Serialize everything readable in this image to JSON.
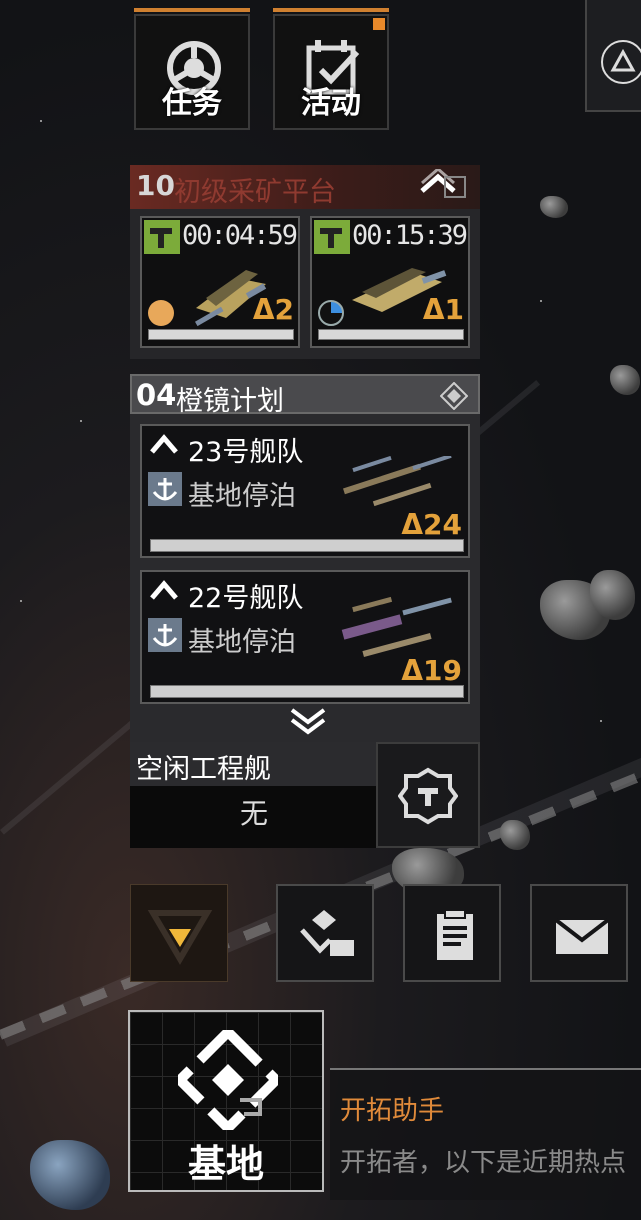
{
  "top_buttons": {
    "missions_label": "任务",
    "activities_label": "活动"
  },
  "mining": {
    "level": "10",
    "title": "初级采矿平台",
    "slots": [
      {
        "timer": "00:04:59",
        "delta": "Δ2"
      },
      {
        "timer": "00:15:39",
        "delta": "Δ1"
      }
    ]
  },
  "plan": {
    "number": "04",
    "title": "橙镜计划",
    "fleets": [
      {
        "name": "23号舰队",
        "status": "基地停泊",
        "delta": "Δ24"
      },
      {
        "name": "22号舰队",
        "status": "基地停泊",
        "delta": "Δ19"
      }
    ]
  },
  "idle": {
    "title": "空闲工程舰",
    "value": "无"
  },
  "base": {
    "label": "基地"
  },
  "assistant": {
    "name": "开拓助手",
    "message": "开拓者，以下是近期热点"
  },
  "colors": {
    "accent_orange": "#e4a23b",
    "mining_tag_green": "#7cab3a",
    "assistant_orange": "#e08a3a"
  }
}
